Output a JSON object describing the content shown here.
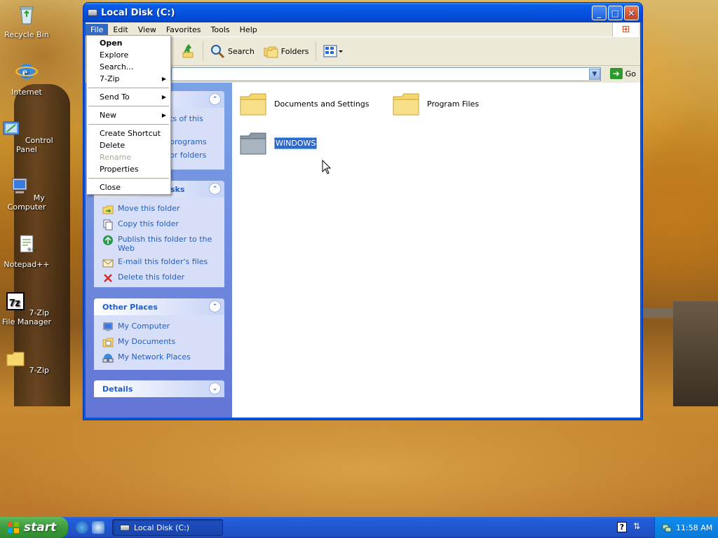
{
  "desktop": {
    "icons": [
      {
        "label": "Recycle Bin"
      },
      {
        "label": "Internet"
      },
      {
        "label": "Control Panel"
      },
      {
        "label": "My Computer"
      },
      {
        "label": "Notepad++"
      },
      {
        "label": "7-Zip File Manager"
      },
      {
        "label": "7-Zip"
      }
    ]
  },
  "window": {
    "title": "Local Disk (C:)",
    "menubar": [
      "File",
      "Edit",
      "View",
      "Favorites",
      "Tools",
      "Help"
    ],
    "toolbar": {
      "search": "Search",
      "folders": "Folders"
    },
    "address": {
      "go": "Go"
    },
    "file_tasks": {
      "partial_lines": [
        "ts of this",
        "programs",
        "or folders"
      ]
    },
    "folder_tasks": {
      "title_partial": "sks",
      "items": [
        "Move this folder",
        "Copy this folder",
        "Publish this folder to the Web",
        "E-mail this folder's files",
        "Delete this folder"
      ]
    },
    "other_places": {
      "title": "Other Places",
      "items": [
        "My Computer",
        "My Documents",
        "My Network Places"
      ]
    },
    "details": {
      "title": "Details"
    },
    "folders": [
      {
        "name": "Documents and Settings"
      },
      {
        "name": "Program Files"
      },
      {
        "name": "WINDOWS"
      }
    ]
  },
  "file_menu": {
    "items": [
      "Open",
      "Explore",
      "Search...",
      "7-Zip",
      "Send To",
      "New",
      "Create Shortcut",
      "Delete",
      "Rename",
      "Properties",
      "Close"
    ]
  },
  "taskbar": {
    "start": "start",
    "task": "Local Disk (C:)",
    "clock": "11:58 AM"
  },
  "colors": {
    "accent": "#316ac5",
    "task_link": "#215dc6",
    "start_green": "#3c9a3c"
  }
}
